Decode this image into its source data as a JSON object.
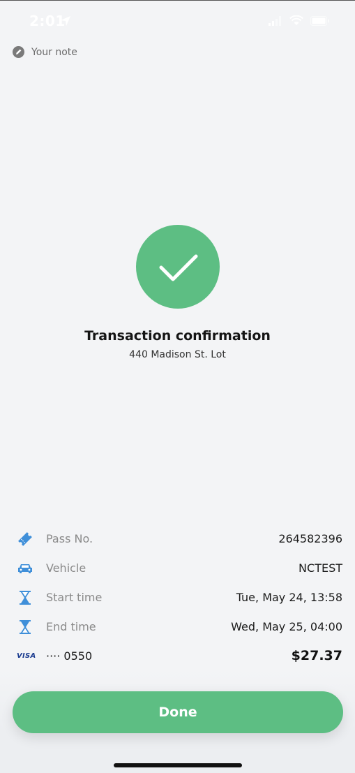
{
  "status_bar": {
    "time": "2:01"
  },
  "note": {
    "label": "Your note"
  },
  "confirmation": {
    "title": "Transaction confirmation",
    "location": "440 Madison St. Lot"
  },
  "details": [
    {
      "icon": "ticket-icon",
      "label": "Pass No.",
      "value": "264582396"
    },
    {
      "icon": "car-icon",
      "label": "Vehicle",
      "value": "NCTEST"
    },
    {
      "icon": "hourglass-icon",
      "label": "Start time",
      "value": "Tue, May 24, 13:58"
    },
    {
      "icon": "hourglass-icon",
      "label": "End time",
      "value": "Wed, May 25, 04:00"
    }
  ],
  "payment": {
    "brand": "VISA",
    "card": "···· 0550",
    "amount": "$27.37"
  },
  "done_button": {
    "label": "Done"
  },
  "colors": {
    "accent": "#5dbe83",
    "icon_blue": "#3f8fd9",
    "background": "#f3f4f6"
  }
}
